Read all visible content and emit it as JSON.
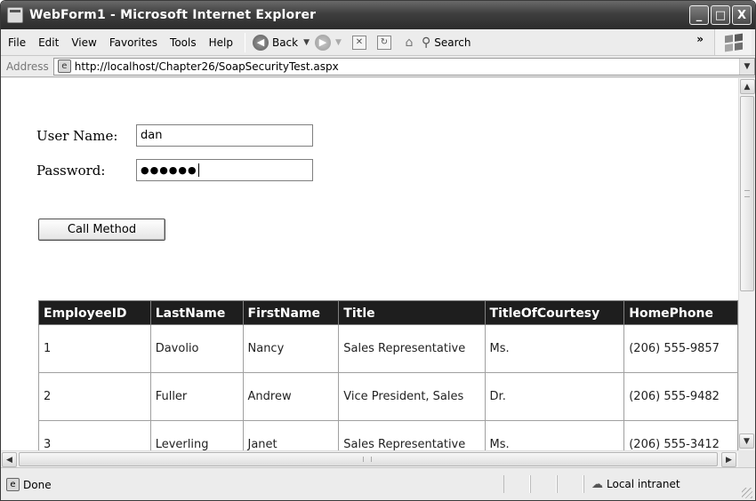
{
  "window": {
    "title": "WebForm1 - Microsoft Internet Explorer",
    "minimize": "_",
    "maximize": "□",
    "close": "X"
  },
  "menu": {
    "items": [
      "File",
      "Edit",
      "View",
      "Favorites",
      "Tools",
      "Help"
    ]
  },
  "toolbar": {
    "back_label": "Back",
    "search_label": "Search",
    "more": "»"
  },
  "address": {
    "label": "Address",
    "url": "http://localhost/Chapter26/SoapSecurityTest.aspx"
  },
  "form": {
    "username_label": "User Name:",
    "username_value": "dan",
    "password_label": "Password:",
    "password_mask": "●●●●●●",
    "button_label": "Call Method"
  },
  "table": {
    "columns": [
      "EmployeeID",
      "LastName",
      "FirstName",
      "Title",
      "TitleOfCourtesy",
      "HomePhone"
    ],
    "rows": [
      [
        "1",
        "Davolio",
        "Nancy",
        "Sales Representative",
        "Ms.",
        "(206) 555-9857"
      ],
      [
        "2",
        "Fuller",
        "Andrew",
        "Vice President, Sales",
        "Dr.",
        "(206) 555-9482"
      ],
      [
        "3",
        "Leverling",
        "Janet",
        "Sales Representative",
        "Ms.",
        "(206) 555-3412"
      ]
    ]
  },
  "status": {
    "text": "Done",
    "zone": "Local intranet"
  }
}
